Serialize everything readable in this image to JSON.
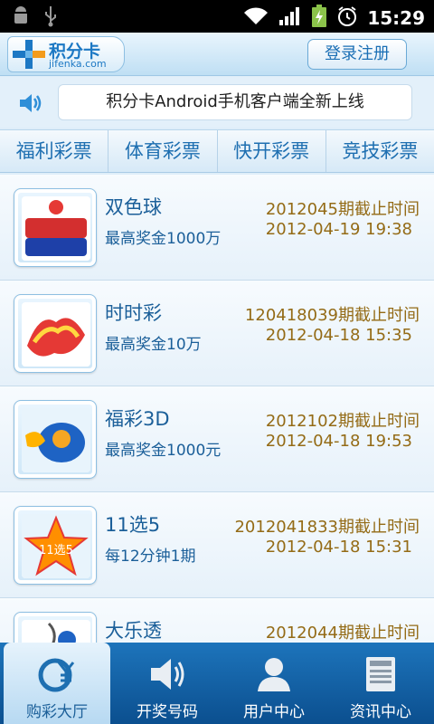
{
  "status_bar": {
    "time": "15:29"
  },
  "header": {
    "logo_title": "积分卡",
    "logo_site": "jifenka.com",
    "login_label": "登录注册"
  },
  "notice": {
    "text": "积分卡Android手机客户端全新上线"
  },
  "tabs": [
    {
      "label": "福利彩票"
    },
    {
      "label": "体育彩票"
    },
    {
      "label": "快开彩票"
    },
    {
      "label": "竞技彩票"
    }
  ],
  "lotteries": [
    {
      "name": "双色球",
      "prize": "最高奖金1000万",
      "period": "2012045期截止时间",
      "deadline": "2012-04-19 19:38",
      "icon": "union-lotto-icon"
    },
    {
      "name": "时时彩",
      "prize": "最高奖金10万",
      "period": "120418039期截止时间",
      "deadline": "2012-04-18 15:35",
      "icon": "shishicai-icon"
    },
    {
      "name": "福彩3D",
      "prize": "最高奖金1000元",
      "period": "2012102期截止时间",
      "deadline": "2012-04-18 19:53",
      "icon": "fucai-3d-icon"
    },
    {
      "name": "11选5",
      "prize": "每12分钟1期",
      "period": "2012041833期截止时间",
      "deadline": "2012-04-18 15:31",
      "icon": "star-11x5-icon",
      "icon_text": "11选5"
    },
    {
      "name": "大乐透",
      "prize": "",
      "period": "2012044期截止时间",
      "deadline": "",
      "icon": "daletou-icon"
    }
  ],
  "bottom_nav": [
    {
      "label": "购彩大厅",
      "icon": "yuan-icon",
      "active": true
    },
    {
      "label": "开奖号码",
      "icon": "speaker-icon",
      "active": false
    },
    {
      "label": "用户中心",
      "icon": "user-icon",
      "active": false
    },
    {
      "label": "资讯中心",
      "icon": "news-icon",
      "active": false
    }
  ],
  "colors": {
    "accent_blue": "#1b5f99",
    "deadline_gold": "#946b16",
    "nav_blue": "#0b4f8f"
  }
}
